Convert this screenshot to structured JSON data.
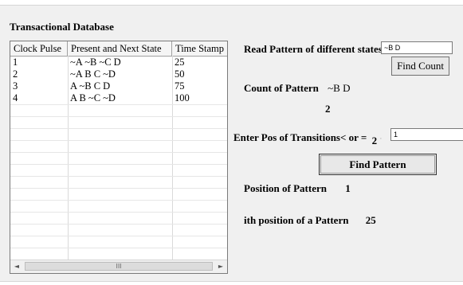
{
  "groupbox_title": "Transactional Database",
  "table": {
    "columns": [
      "Clock Pulse",
      "Present and Next State",
      "Time Stamp"
    ],
    "rows": [
      [
        "1",
        "~A ~B ~C D",
        "25"
      ],
      [
        "2",
        "~A B C ~D",
        "50"
      ],
      [
        "3",
        "A ~B C D",
        "75"
      ],
      [
        "4",
        "A B ~C ~D",
        "100"
      ]
    ],
    "scroll_thumb_glyph": "III",
    "scroll_left_glyph": "◄",
    "scroll_right_glyph": "►"
  },
  "read_pattern": {
    "label": "Read Pattern of different states",
    "value": "~B D"
  },
  "find_count_button": "Find Count",
  "count": {
    "label": "Count of Pattern",
    "pattern": "~B D",
    "value": "2"
  },
  "transitions": {
    "label": "Enter Pos of Transitions< or =",
    "limit": "2",
    "value": "1"
  },
  "find_pattern_button": "Find Pattern",
  "position": {
    "label": "Position of Pattern",
    "value": "1"
  },
  "ith_position": {
    "label": "ith position of a Pattern",
    "value": "25"
  }
}
